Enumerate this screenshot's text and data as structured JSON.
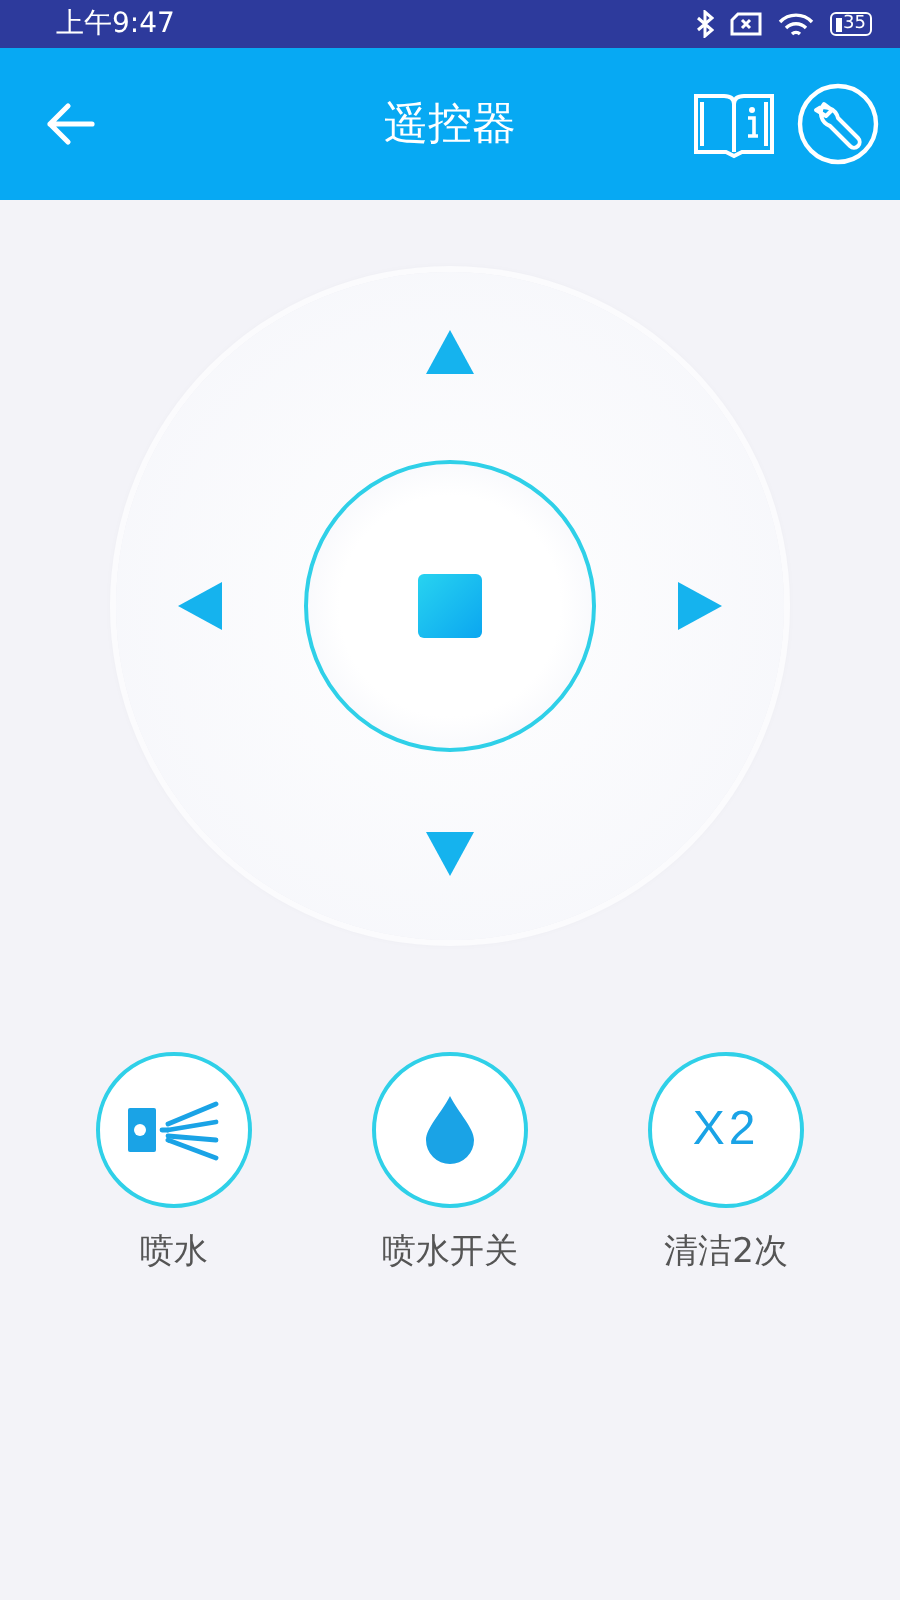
{
  "status_bar": {
    "time": "上午9:47",
    "battery": "35"
  },
  "header": {
    "title": "遥控器"
  },
  "actions": [
    {
      "kind": "spray",
      "label": "喷水"
    },
    {
      "kind": "drop",
      "label": "喷水开关"
    },
    {
      "kind": "text",
      "text": "X2",
      "label": "清洁2次"
    }
  ]
}
